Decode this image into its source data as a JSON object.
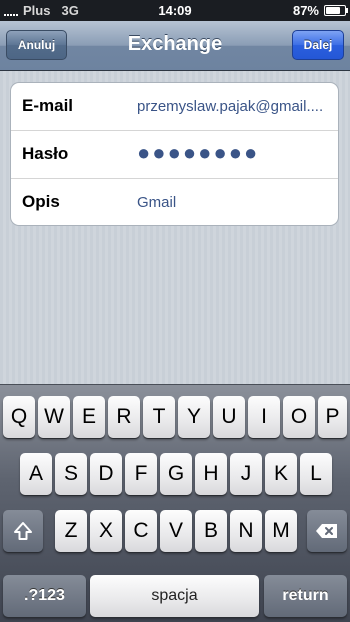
{
  "status_bar": {
    "carrier": "Plus",
    "network": "3G",
    "time": "14:09",
    "battery_percent": "87%",
    "battery_level": 0.87
  },
  "navbar": {
    "title": "Exchange",
    "cancel_label": "Anuluj",
    "next_label": "Dalej"
  },
  "form": {
    "rows": [
      {
        "label": "E-mail",
        "value": "przemyslaw.pajak@gmail...."
      },
      {
        "label": "Hasło",
        "value": "●●●●●●●●"
      },
      {
        "label": "Opis",
        "value": "Gmail"
      }
    ]
  },
  "keyboard": {
    "row1": [
      "Q",
      "W",
      "E",
      "R",
      "T",
      "Y",
      "U",
      "I",
      "O",
      "P"
    ],
    "row2": [
      "A",
      "S",
      "D",
      "F",
      "G",
      "H",
      "J",
      "K",
      "L"
    ],
    "row3": [
      "Z",
      "X",
      "C",
      "V",
      "B",
      "N",
      "M"
    ],
    "numbers_label": ".?123",
    "space_label": "spacja",
    "return_label": "return",
    "shift_icon": "shift-arrow-icon",
    "backspace_icon": "backspace-icon"
  },
  "colors": {
    "navbar": "#7186a2",
    "next_button": "#2b5fde",
    "value_text": "#3a5487"
  }
}
